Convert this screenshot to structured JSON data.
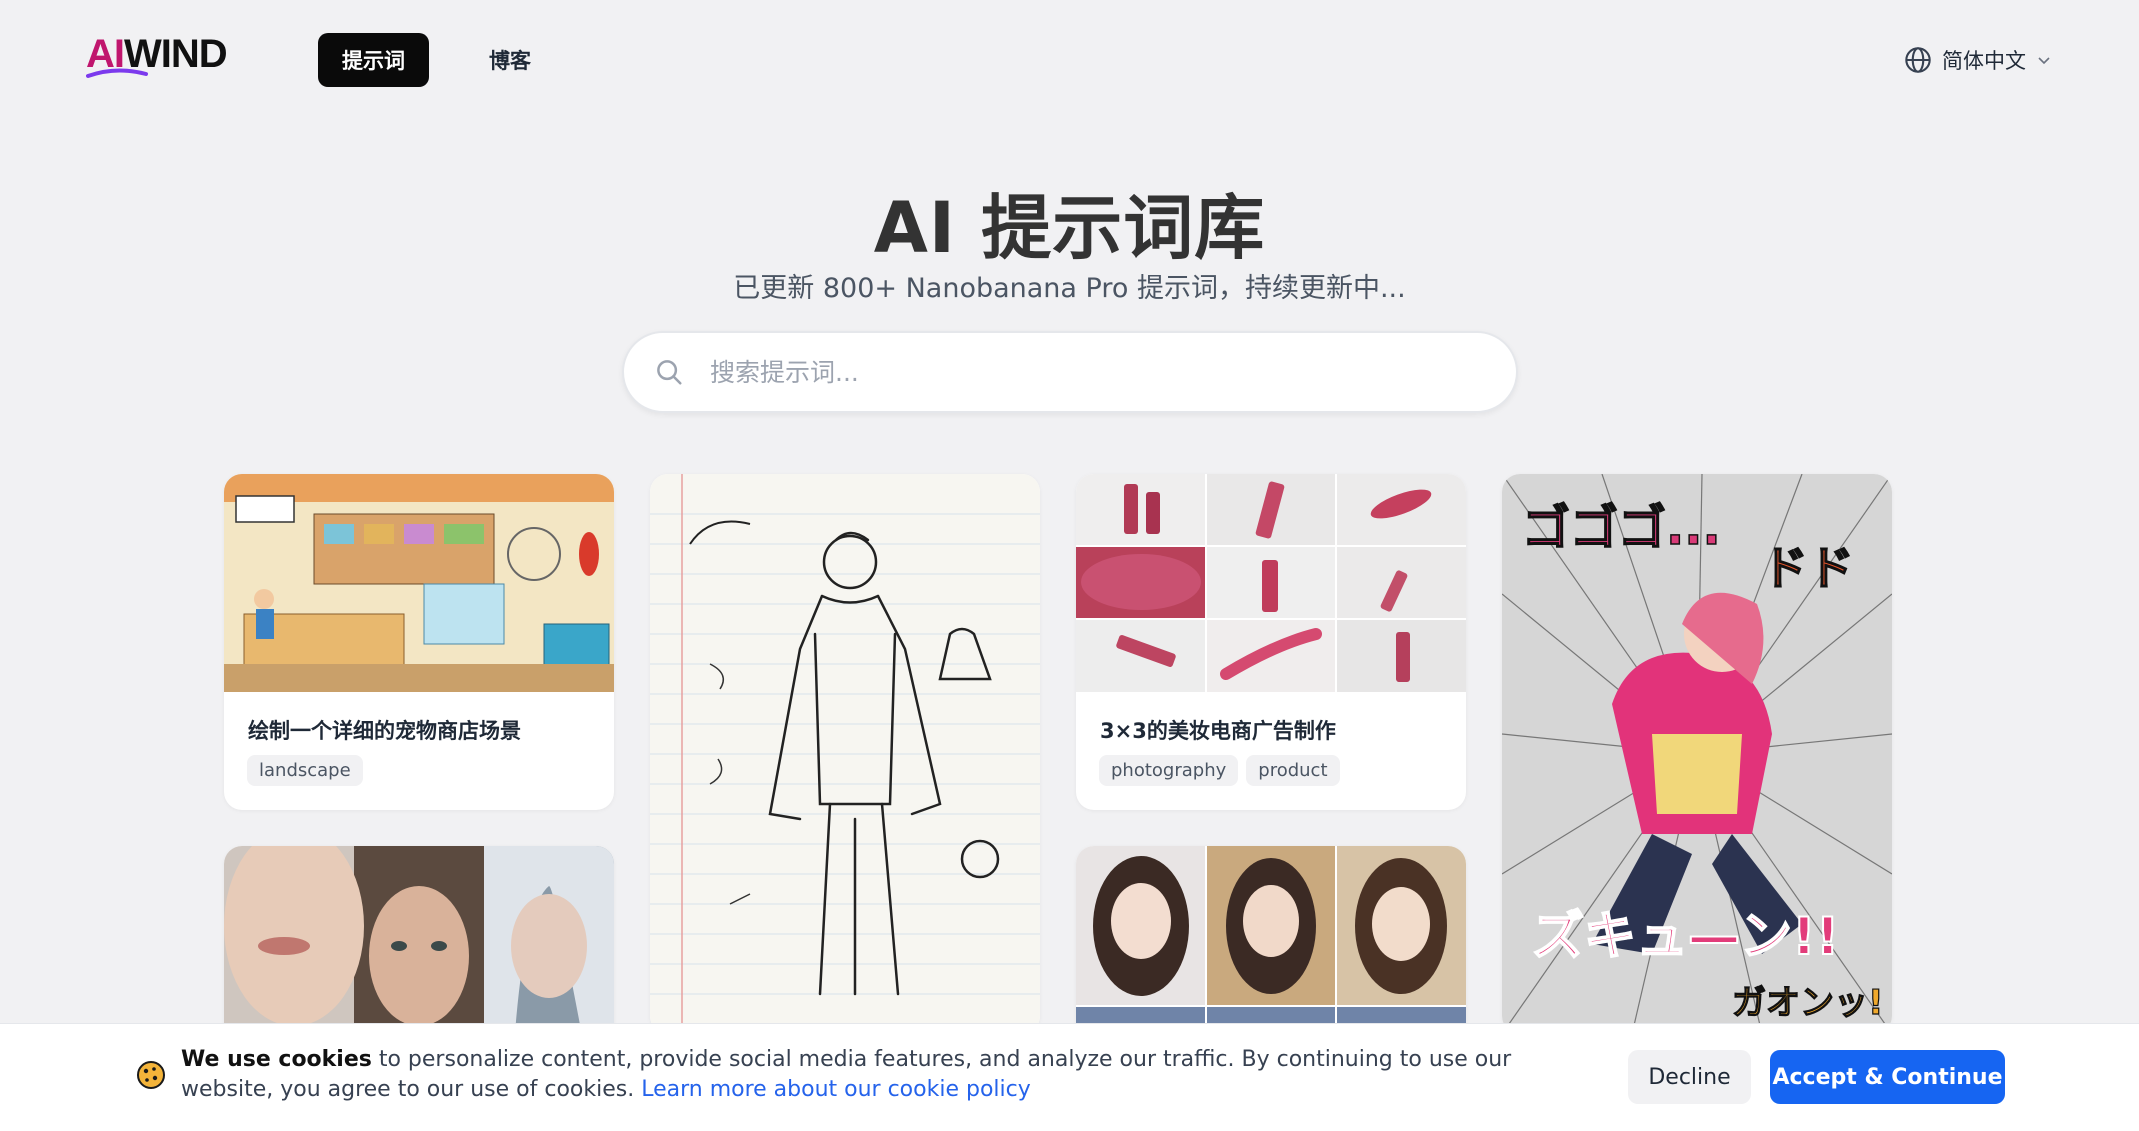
{
  "header": {
    "logo_ai": "AI",
    "logo_wind": "WIND",
    "nav": [
      {
        "label": "提示词"
      },
      {
        "label": "博客"
      }
    ],
    "language": "简体中文"
  },
  "hero": {
    "title": "AI 提示词库",
    "subtitle": "已更新 800+ Nanobanana Pro 提示词，持续更新中..."
  },
  "search": {
    "placeholder": "搜索提示词..."
  },
  "cards": [
    {
      "title": "绘制一个详细的宠物商店场景",
      "tags": [
        "landscape"
      ]
    },
    {
      "title": "3×3的美妆电商广告制作",
      "tags": [
        "photography",
        "product"
      ]
    }
  ],
  "cookie": {
    "lead": "We use cookies",
    "text": " to personalize content, provide social media features, and analyze our traffic. By continuing to use our website, you agree to our use of cookies. ",
    "link": "Learn more about our cookie policy",
    "decline": "Decline",
    "accept": "Accept & Continue"
  }
}
